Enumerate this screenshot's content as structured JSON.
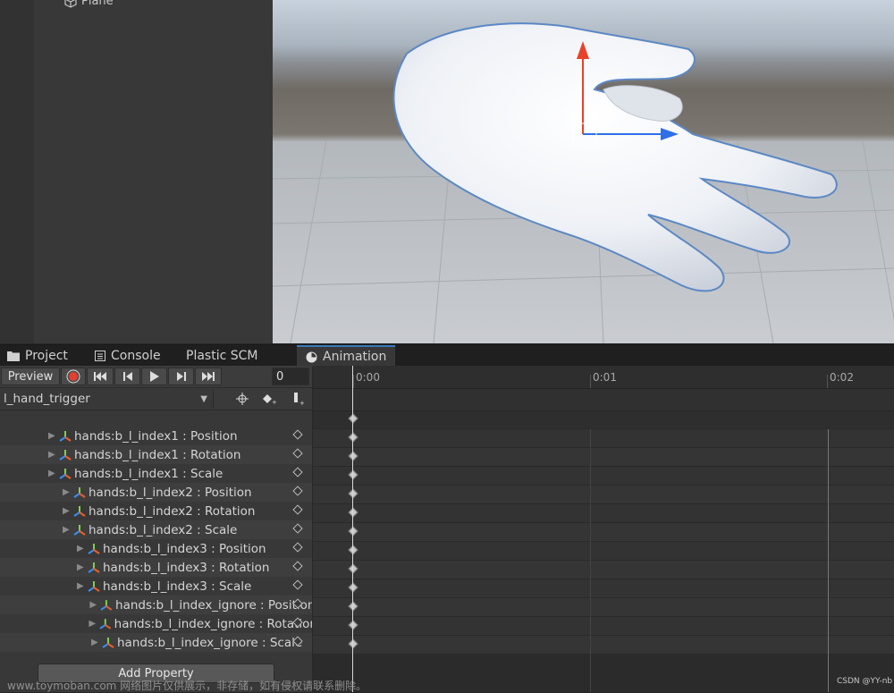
{
  "hierarchy": {
    "item_label": "Plane"
  },
  "tabs": [
    {
      "label": "Project",
      "icon": "folder-icon"
    },
    {
      "label": "Console",
      "icon": "console-icon"
    },
    {
      "label": "Plastic SCM"
    },
    {
      "label": "Animation",
      "icon": "clock-icon",
      "active": true
    }
  ],
  "toolbar": {
    "preview_label": "Preview",
    "frame_value": "0"
  },
  "clip": {
    "name": "l_hand_trigger"
  },
  "timeline": {
    "ticks": [
      "0:00",
      "0:01",
      "0:02"
    ]
  },
  "properties": [
    {
      "label": "hands:b_l_index1 : Position",
      "indent": 0
    },
    {
      "label": "hands:b_l_index1 : Rotation",
      "indent": 0
    },
    {
      "label": "hands:b_l_index1 : Scale",
      "indent": 0
    },
    {
      "label": "hands:b_l_index2 : Position",
      "indent": 1
    },
    {
      "label": "hands:b_l_index2 : Rotation",
      "indent": 1
    },
    {
      "label": "hands:b_l_index2 : Scale",
      "indent": 1
    },
    {
      "label": "hands:b_l_index3 : Position",
      "indent": 2
    },
    {
      "label": "hands:b_l_index3 : Rotation",
      "indent": 2
    },
    {
      "label": "hands:b_l_index3 : Scale",
      "indent": 2
    },
    {
      "label": "hands:b_l_index_ignore : Position",
      "indent": 3
    },
    {
      "label": "hands:b_l_index_ignore : Rotation",
      "indent": 3
    },
    {
      "label": "hands:b_l_index_ignore : Scale",
      "indent": 3
    }
  ],
  "add_property_label": "Add Property",
  "watermark": "www.toymoban.com 网络图片仅供展示，非存储，如有侵权请联系删除。",
  "watermark2": "CSDN @YY-nb",
  "colors": {
    "accent": "#3a79bb",
    "record": "#e0402f",
    "gizmo_y": "#e8422a",
    "gizmo_z": "#2f6fe8"
  }
}
